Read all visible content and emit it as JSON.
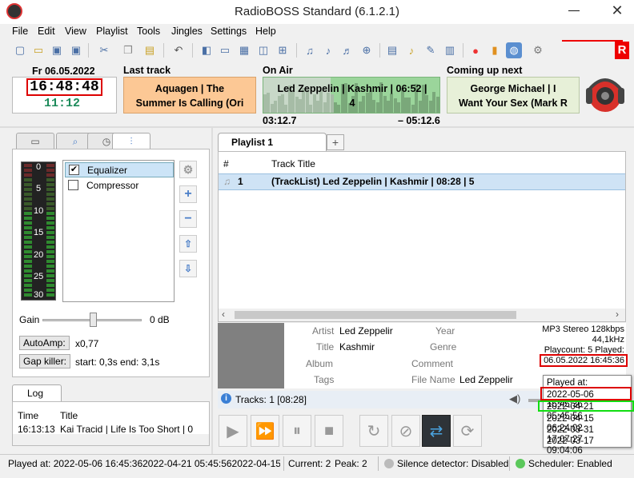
{
  "window": {
    "title": "RadioBOSS Standard (6.1.2.1)",
    "minimize": "—",
    "close": "✕"
  },
  "menu": [
    "File",
    "Edit",
    "View",
    "Playlist",
    "Tools",
    "Jingles",
    "Settings",
    "Help"
  ],
  "brand_letter": "R",
  "clock": {
    "date": "Fr 06.05.2022",
    "time": "16:48:48",
    "countdown": "11:12"
  },
  "last_track": {
    "label": "Last track",
    "line1": "Aquagen | The",
    "line2": "Summer Is Calling (Ori"
  },
  "on_air": {
    "label": "On Air",
    "line1": "Led Zeppelin | Kashmir | 06:52 |",
    "line2": "4",
    "elapsed": "03:12.7",
    "remaining": "– 05:12.6",
    "progress": 0.38
  },
  "coming_next": {
    "label": "Coming up next",
    "line1": "George Michael | I",
    "line2": "Want Your Sex (Mark R"
  },
  "effects": {
    "items": [
      {
        "label": "Equalizer",
        "checked": true
      },
      {
        "label": "Compressor",
        "checked": false
      }
    ],
    "meter_labels": [
      "0",
      "5",
      "10",
      "15",
      "20",
      "25",
      "30"
    ],
    "gain_label": "Gain",
    "gain_value": "0 dB",
    "autoamp_label": "AutoAmp:",
    "autoamp_value": "x0,77",
    "gapkiller_label": "Gap killer:",
    "gapkiller_value": "start: 0,3s end: 3,1s"
  },
  "log": {
    "tab": "Log",
    "col_time": "Time",
    "col_title": "Title",
    "row_time": "16:13:13",
    "row_title": "Kai Tracid | Life Is Too Short | 0"
  },
  "playlist": {
    "tab": "Playlist 1",
    "add_tab": "+",
    "col_num": "#",
    "col_title": "Track Title",
    "rows": [
      {
        "num": "1",
        "title": "(TrackList) Led Zeppelin | Kashmir | 08:28 | 5"
      }
    ]
  },
  "info": {
    "artist_label": "Artist",
    "artist": "Led Zeppelir",
    "title_label": "Title",
    "title": "Kashmir",
    "album_label": "Album",
    "tags_label": "Tags",
    "year_label": "Year",
    "genre_label": "Genre",
    "comment_label": "Comment",
    "filename_label": "File Name",
    "filename": "Led Zeppelir",
    "format": "MP3 Stereo 128kbps",
    "rate": "44,1kHz",
    "playcount": "Playcount: 5  Played:",
    "last_played": "06.05.2022 16:45:36"
  },
  "tracks_status": "Tracks: 1 [08:28]",
  "played_popup": {
    "header": "Played at:",
    "entries": [
      "2022-05-06 16:45:36",
      "2022-04-21 05:45:56",
      "2022-04-15 06:24:02",
      "2022-03-31 17:07:27",
      "2022-03-17 09:04:06"
    ]
  },
  "status": {
    "played_at": "Played at: 2022-05-06 16:45:362022-04-21 05:45:562022-04-15 06:2",
    "current": "Current: 2",
    "peak": "Peak: 2",
    "silence": "Silence detector: Disabled",
    "scheduler": "Scheduler: Enabled"
  }
}
